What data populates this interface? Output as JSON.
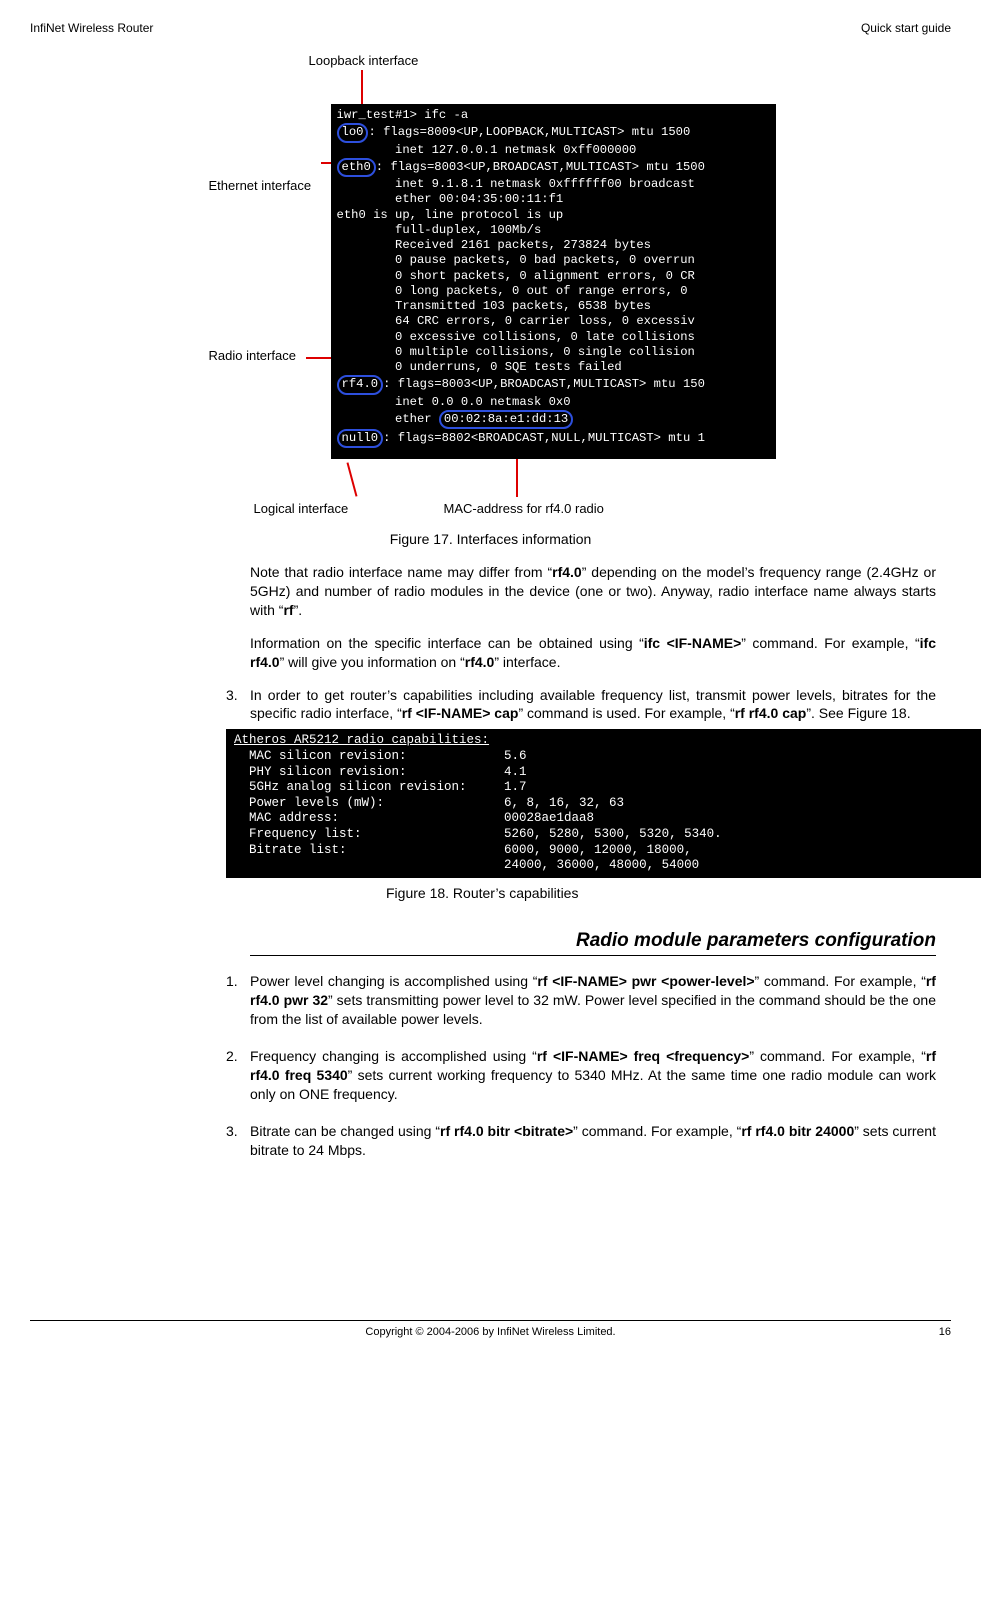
{
  "header": {
    "left": "InfiNet Wireless Router",
    "right": "Quick start guide"
  },
  "labels": {
    "loopback": "Loopback interface",
    "ethernet": "Ethernet interface",
    "radio": "Radio interface",
    "logical": "Logical interface",
    "mac": "MAC-address for rf4.0 radio"
  },
  "term1": {
    "l0": "iwr_test#1> ifc -a",
    "lo0": "lo0",
    "l1": ": flags=8009<UP,LOOPBACK,MULTICAST> mtu 1500",
    "l2": "        inet 127.0.0.1 netmask 0xff000000",
    "eth0": "eth0",
    "l3": ": flags=8003<UP,BROADCAST,MULTICAST> mtu 1500",
    "l4": "        inet 9.1.8.1 netmask 0xffffff00 broadcast",
    "l5": "        ether 00:04:35:00:11:f1",
    "l6": "eth0 is up, line protocol is up",
    "l7": "        full-duplex, 100Mb/s",
    "l8": "        Received 2161 packets, 273824 bytes",
    "l9": "        0 pause packets, 0 bad packets, 0 overrun",
    "l10": "        0 short packets, 0 alignment errors, 0 CR",
    "l11": "        0 long packets, 0 out of range errors, 0",
    "l12": "        Transmitted 103 packets, 6538 bytes",
    "l13": "        64 CRC errors, 0 carrier loss, 0 excessiv",
    "l14": "        0 excessive collisions, 0 late collisions",
    "l15": "        0 multiple collisions, 0 single collision",
    "l16": "        0 underruns, 0 SQE tests failed",
    "rf40": "rf4.0",
    "l17": ": flags=8003<UP,BROADCAST,MULTICAST> mtu 150",
    "l18a": "        inet 0.0 0.0 netmask 0x0",
    "mac_hl": "00:02:8a:e1:dd:13",
    "l19a": "        ether ",
    "null0": "null0",
    "l20": ": flags=8802<BROADCAST,NULL,MULTICAST> mtu 1"
  },
  "fig17": "Figure 17. Interfaces information",
  "para1_a": "Note that radio interface name may differ from “",
  "para1_b": "rf4.0",
  "para1_c": "” depending on the model’s frequency range (2.4GHz or 5GHz) and number of radio modules in the device (one or two). Anyway, radio interface name always starts with “",
  "para1_d": "rf",
  "para1_e": "”.",
  "para2_a": "Information on the specific interface can be obtained using “",
  "para2_b": "ifc <IF-NAME>",
  "para2_c": "” command. For example, “",
  "para2_d": "ifc rf4.0",
  "para2_e": "” will give you information on “",
  "para2_f": "rf4.0",
  "para2_g": "” interface.",
  "item3_n": "3.",
  "item3_a": "In order to get router’s capabilities including available frequency list, transmit power levels, bitrates for the specific radio interface, “",
  "item3_b": "rf <IF-NAME> cap",
  "item3_c": "” command is used. For example, “",
  "item3_d": "rf rf4.0 cap",
  "item3_e": "”. See Figure 18.",
  "term2": {
    "l0": "Atheros AR5212 radio capabilities:",
    "l1": "  MAC silicon revision:             5.6",
    "l2": "  PHY silicon revision:             4.1",
    "l3": "  5GHz analog silicon revision:     1.7",
    "l4": "  Power levels (mW):                6, 8, 16, 32, 63",
    "l5": "  MAC address:                      00028ae1daa8",
    "l6": "  Frequency list:                   5260, 5280, 5300, 5320, 5340.",
    "l7": "  Bitrate list:                     6000, 9000, 12000, 18000,",
    "l8": "                                    24000, 36000, 48000, 54000"
  },
  "fig18": "Figure 18. Router’s capabilities",
  "section": "Radio module parameters configuration",
  "s1_n": "1.",
  "s1_a": "Power level changing is accomplished using “",
  "s1_b": "rf <IF-NAME> pwr <power-level>",
  "s1_c": "” command. For example, “",
  "s1_d": "rf rf4.0 pwr 32",
  "s1_e": "” sets transmitting power level to 32 mW. Power level specified in the command should be the one from the list of available power levels.",
  "s2_n": "2.",
  "s2_a": "Frequency changing is accomplished using “",
  "s2_b": "rf <IF-NAME> freq <frequency>",
  "s2_c": "” command. For example, “",
  "s2_d": "rf rf4.0 freq 5340",
  "s2_e": "” sets current working frequency to 5340 MHz. At the same time one radio module can work only on ONE frequency.",
  "s3_n": "3.",
  "s3_a": "Bitrate can be changed using “",
  "s3_b": "rf rf4.0 bitr <bitrate>",
  "s3_c": "” command. For example, “",
  "s3_d": "rf rf4.0 bitr 24000",
  "s3_e": "” sets current bitrate to 24 Mbps.",
  "footer": {
    "copy": "Copyright © 2004-2006 by InfiNet Wireless Limited.",
    "page": "16"
  }
}
